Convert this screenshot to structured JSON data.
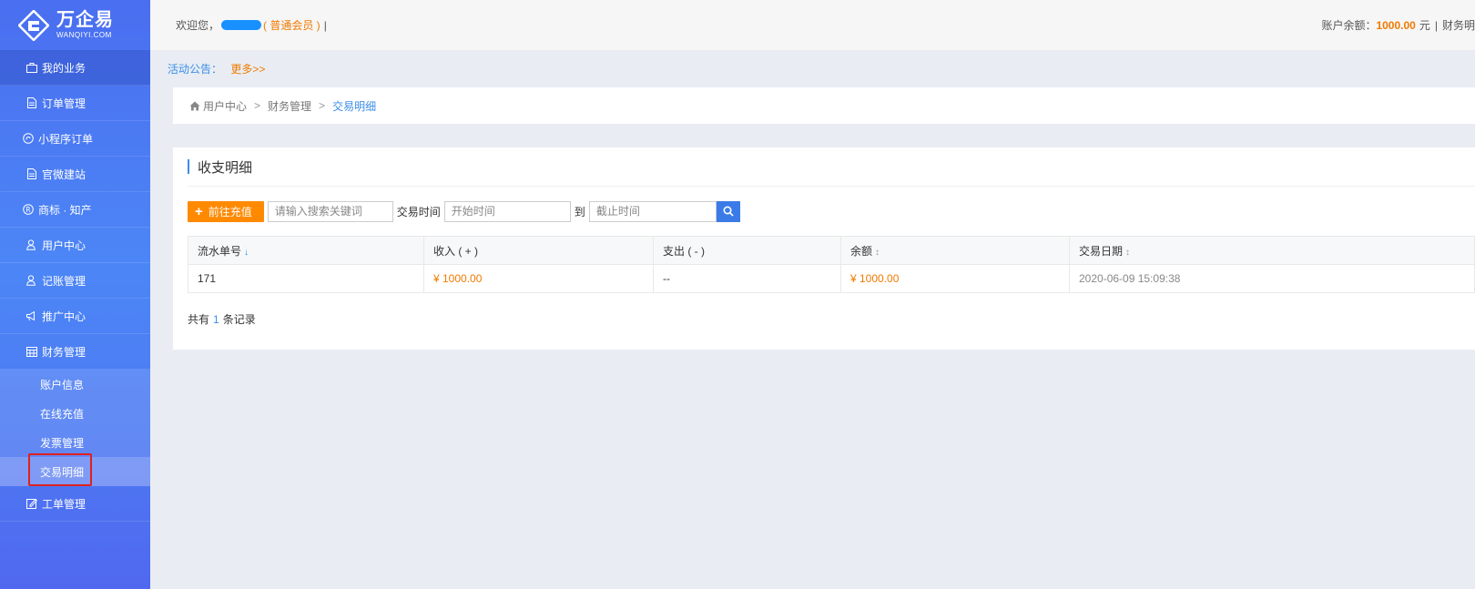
{
  "brand": {
    "name_cn": "万企易",
    "name_en": "WANQIYI.COM"
  },
  "sidebar": {
    "items": [
      {
        "label": "我的业务",
        "icon": "briefcase-icon"
      },
      {
        "label": "订单管理",
        "icon": "document-icon"
      },
      {
        "label": "小程序订单",
        "icon": "miniprogram-icon"
      },
      {
        "label": "官微建站",
        "icon": "document-icon"
      },
      {
        "label": "商标 · 知产",
        "icon": "registered-icon"
      },
      {
        "label": "用户中心",
        "icon": "user-icon"
      },
      {
        "label": "记账管理",
        "icon": "user-icon"
      },
      {
        "label": "推广中心",
        "icon": "megaphone-icon"
      },
      {
        "label": "财务管理",
        "icon": "calendar-icon"
      }
    ],
    "finance_sub": [
      "账户信息",
      "在线充值",
      "发票管理",
      "交易明细"
    ],
    "last_item": {
      "label": "工单管理",
      "icon": "edit-icon"
    }
  },
  "topbar": {
    "welcome": "欢迎您，",
    "member_level": "( 普通会员 )",
    "divider": "|",
    "balance_label": "账户余额：",
    "balance_value": "1000.00",
    "balance_unit": "元",
    "right_divider": "|",
    "right_link": "财务明"
  },
  "notice": {
    "label": "活动公告：",
    "more": "更多>>"
  },
  "breadcrumb": {
    "home": "用户中心",
    "sep1": ">",
    "level2": "财务管理",
    "sep2": ">",
    "current": "交易明细"
  },
  "section": {
    "title": "收支明细"
  },
  "toolbar": {
    "recharge_label": "前往充值",
    "keyword_placeholder": "请输入搜索关键词",
    "time_label": "交易时间",
    "start_placeholder": "开始时间",
    "to_label": "到",
    "end_placeholder": "截止时间"
  },
  "table": {
    "headers": [
      "流水单号",
      "收入 ( + )",
      "支出 ( - )",
      "余额",
      "交易日期"
    ],
    "rows": [
      [
        "171",
        "¥ 1000.00",
        "--",
        "¥ 1000.00",
        "2020-06-09 15:09:38"
      ]
    ]
  },
  "footer": {
    "prefix": "共有",
    "count": "1",
    "suffix": "条记录"
  },
  "colors": {
    "accent_orange": "#ff8a00",
    "link_blue": "#3b8ee8",
    "sidebar_blue": "#4c86f6",
    "highlight_red": "#e02020"
  }
}
